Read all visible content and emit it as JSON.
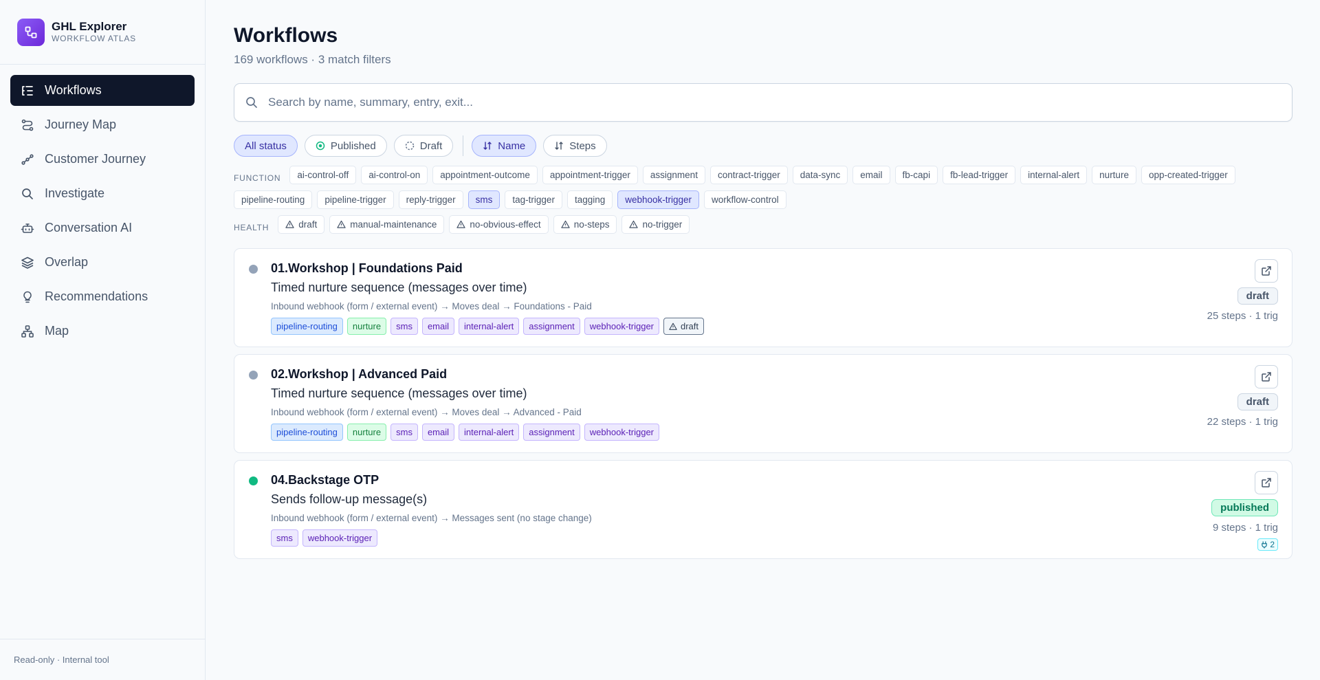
{
  "brand": {
    "title": "GHL Explorer",
    "subtitle": "WORKFLOW ATLAS"
  },
  "nav": [
    {
      "label": "Workflows",
      "icon": "list-icon",
      "active": true
    },
    {
      "label": "Journey Map",
      "icon": "route-icon"
    },
    {
      "label": "Customer Journey",
      "icon": "spline-icon"
    },
    {
      "label": "Investigate",
      "icon": "search-icon"
    },
    {
      "label": "Conversation AI",
      "icon": "bot-icon"
    },
    {
      "label": "Overlap",
      "icon": "layers-icon"
    },
    {
      "label": "Recommendations",
      "icon": "lightbulb-icon"
    },
    {
      "label": "Map",
      "icon": "network-icon"
    }
  ],
  "footer": "Read-only · Internal tool",
  "page": {
    "title": "Workflows",
    "subtitle": "169 workflows · 3 match filters",
    "search_placeholder": "Search by name, summary, entry, exit..."
  },
  "filters": {
    "status": [
      {
        "label": "All status",
        "selected": true
      },
      {
        "label": "Published",
        "icon": "circle-check-icon"
      },
      {
        "label": "Draft",
        "icon": "circle-dashed-icon"
      }
    ],
    "sort": [
      {
        "label": "Name",
        "selected": true
      },
      {
        "label": "Steps"
      }
    ]
  },
  "function_label": "FUNCTION",
  "function_tags": [
    {
      "label": "ai-control-off"
    },
    {
      "label": "ai-control-on"
    },
    {
      "label": "appointment-outcome"
    },
    {
      "label": "appointment-trigger"
    },
    {
      "label": "assignment"
    },
    {
      "label": "contract-trigger"
    },
    {
      "label": "data-sync"
    },
    {
      "label": "email"
    },
    {
      "label": "fb-capi"
    },
    {
      "label": "fb-lead-trigger"
    },
    {
      "label": "internal-alert"
    },
    {
      "label": "nurture"
    },
    {
      "label": "opp-created-trigger"
    },
    {
      "label": "pipeline-routing"
    },
    {
      "label": "pipeline-trigger"
    },
    {
      "label": "reply-trigger"
    },
    {
      "label": "sms",
      "selected": true
    },
    {
      "label": "tag-trigger"
    },
    {
      "label": "tagging"
    },
    {
      "label": "webhook-trigger",
      "selected": true
    },
    {
      "label": "workflow-control"
    }
  ],
  "health_label": "HEALTH",
  "health_tags": [
    {
      "label": "draft"
    },
    {
      "label": "manual-maintenance"
    },
    {
      "label": "no-obvious-effect"
    },
    {
      "label": "no-steps"
    },
    {
      "label": "no-trigger"
    }
  ],
  "colors": {
    "draft_dot": "#94a3b8",
    "published_dot": "#10b981",
    "accent": "#0f172a"
  },
  "workflows": [
    {
      "title": "01.Workshop | Foundations Paid",
      "summary": "Timed nurture sequence (messages over time)",
      "flow": "Inbound webhook (form / external event) → Moves deal → Foundations - Paid",
      "status": "draft",
      "meta": "25 steps · 1 trig",
      "tags": [
        {
          "label": "pipeline-routing",
          "color": "blue"
        },
        {
          "label": "nurture",
          "color": "green"
        },
        {
          "label": "sms",
          "color": "purple"
        },
        {
          "label": "email",
          "color": "purple"
        },
        {
          "label": "internal-alert",
          "color": "purple"
        },
        {
          "label": "assignment",
          "color": "purple"
        },
        {
          "label": "webhook-trigger",
          "color": "purple"
        },
        {
          "label": "draft",
          "color": "gray",
          "icon": "alert-triangle-icon"
        }
      ]
    },
    {
      "title": "02.Workshop | Advanced Paid",
      "summary": "Timed nurture sequence (messages over time)",
      "flow": "Inbound webhook (form / external event) → Moves deal → Advanced - Paid",
      "status": "draft",
      "meta": "22 steps · 1 trig",
      "tags": [
        {
          "label": "pipeline-routing",
          "color": "blue"
        },
        {
          "label": "nurture",
          "color": "green"
        },
        {
          "label": "sms",
          "color": "purple"
        },
        {
          "label": "email",
          "color": "purple"
        },
        {
          "label": "internal-alert",
          "color": "purple"
        },
        {
          "label": "assignment",
          "color": "purple"
        },
        {
          "label": "webhook-trigger",
          "color": "purple"
        }
      ]
    },
    {
      "title": "04.Backstage OTP",
      "summary": "Sends follow-up message(s)",
      "flow": "Inbound webhook (form / external event) → Messages sent (no stage change)",
      "status": "published",
      "meta": "9 steps · 1 trig",
      "plug_count": "2",
      "tags": [
        {
          "label": "sms",
          "color": "purple"
        },
        {
          "label": "webhook-trigger",
          "color": "purple"
        }
      ]
    }
  ]
}
